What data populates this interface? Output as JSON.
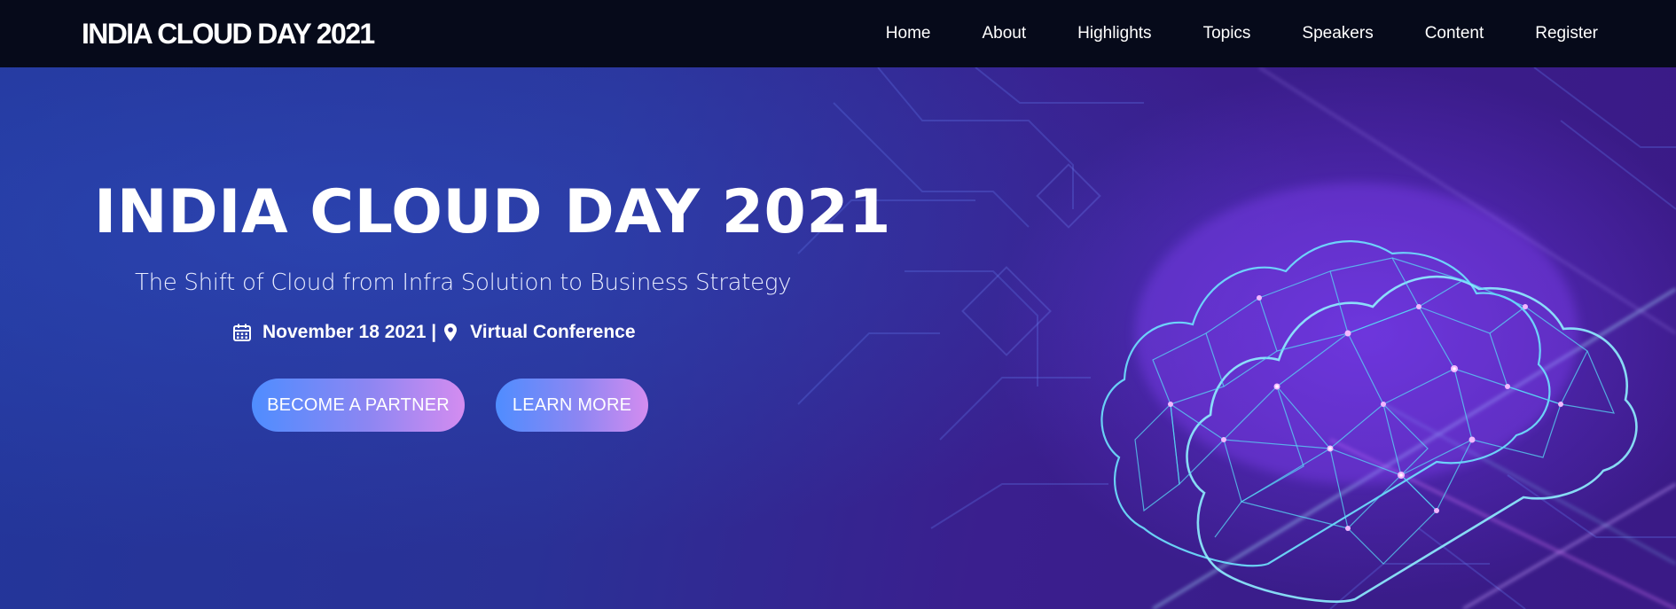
{
  "header": {
    "brand": "INDIA CLOUD DAY 2021",
    "nav": [
      {
        "label": "Home"
      },
      {
        "label": "About"
      },
      {
        "label": "Highlights"
      },
      {
        "label": "Topics"
      },
      {
        "label": "Speakers"
      },
      {
        "label": "Content"
      },
      {
        "label": "Register"
      }
    ]
  },
  "hero": {
    "title": "INDIA CLOUD DAY 2021",
    "subtitle": "The Shift of Cloud from Infra Solution to Business Strategy",
    "date": "November 18 2021 |",
    "location": "Virtual Conference",
    "icons": {
      "date": "calendar-icon",
      "location": "map-pin-icon"
    },
    "buttons": {
      "partner": "BECOME A PARTNER",
      "learn": "LEARN MORE"
    }
  },
  "colors": {
    "navbar": "#060a1a",
    "hero_start": "#23369a",
    "hero_end": "#3a1a86",
    "button_start": "#4f8dff",
    "button_end": "#d48cf0",
    "cloud_wire": "#6fe3ff",
    "cloud_glow": "#e07cff"
  }
}
